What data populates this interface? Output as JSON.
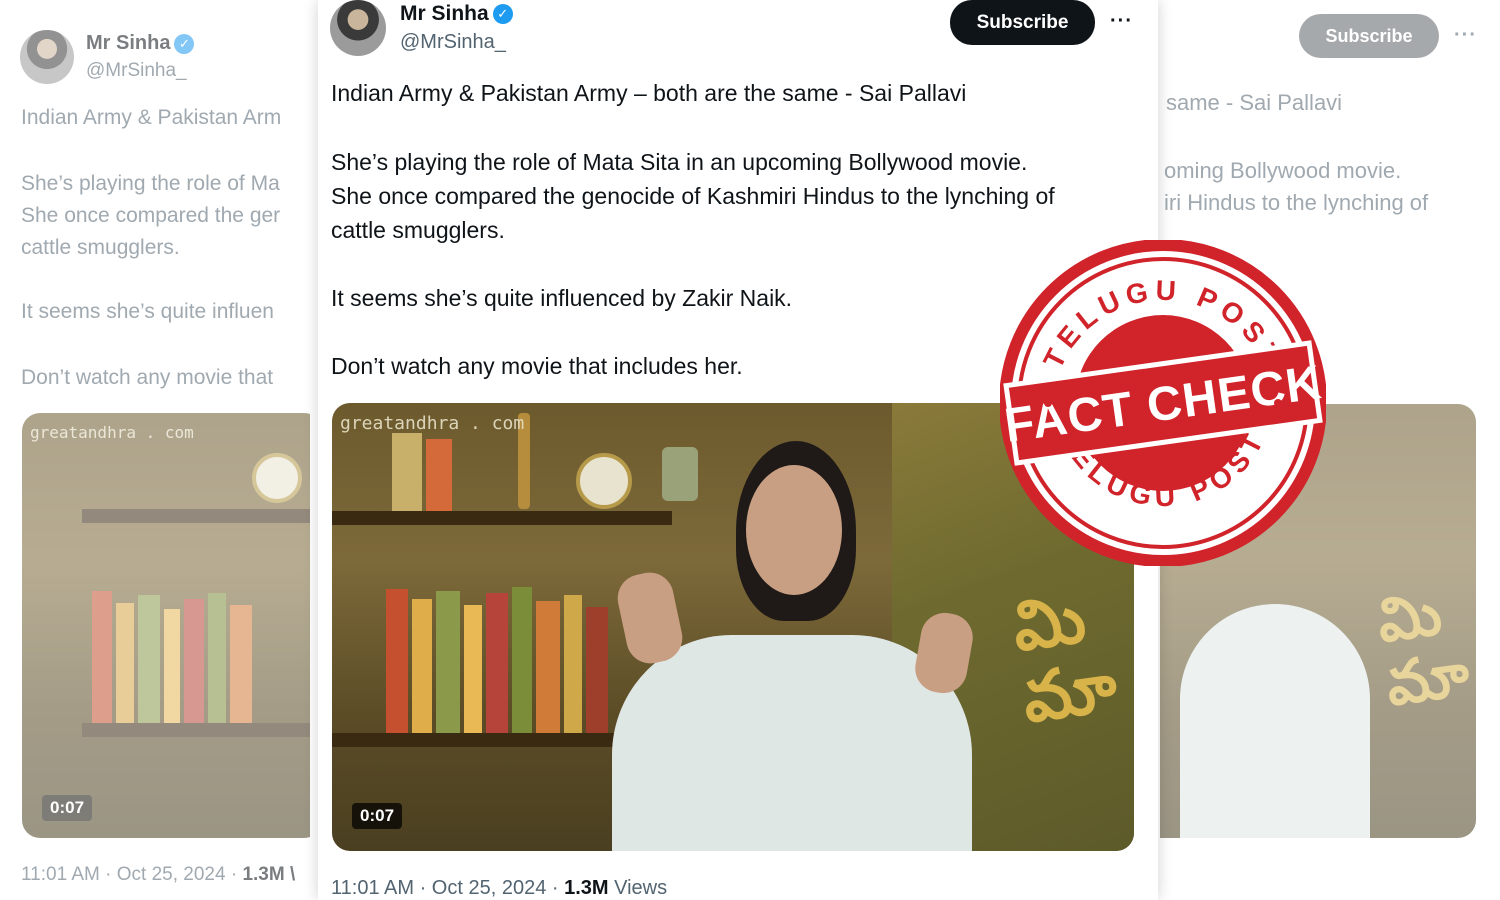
{
  "tweet": {
    "display_name": "Mr Sinha",
    "handle": "@MrSinha_",
    "subscribe_label": "Subscribe",
    "more_label": "···",
    "line1": "Indian Army & Pakistan Army – both are the same - Sai Pallavi",
    "line2": "She’s playing the role of Mata Sita in an upcoming Bollywood movie.",
    "line3": "She once compared the genocide of Kashmiri Hindus to the lynching of",
    "line4": "cattle smugglers.",
    "line5": "It seems she’s quite influenced by Zakir Naik.",
    "line6": "Don’t watch any movie that includes her.",
    "video_watermark": "greatandhra . com",
    "video_duration": "0:07",
    "sign_text": "మి\nమా",
    "timestamp": "11:01 AM · Oct 25, 2024 · ",
    "views_count": "1.3M",
    "views_label": " Views"
  },
  "left_ghost": {
    "display_name": "Mr Sinha",
    "handle": "@MrSinha_",
    "line1": "Indian Army & Pakistan Arm",
    "line2": "She’s playing the role of Ma",
    "line3": "She once compared the ger",
    "line4": "cattle smugglers.",
    "line5": "It seems she’s quite influen",
    "line6": "Don’t watch any movie that",
    "video_watermark": "greatandhra . com",
    "video_duration": "0:07",
    "timestamp": "11:01 AM · Oct 25, 2024 · ",
    "views_count": "1.3M \\"
  },
  "right_ghost": {
    "subscribe_label": "Subscribe",
    "more_label": "···",
    "line1": "same - Sai Pallavi",
    "line2": "oming Bollywood movie.",
    "line3": "iri Hindus to the lynching of"
  },
  "stamp": {
    "top_text": "TELUGU POST",
    "center_text": "FACT CHECK",
    "bottom_text": "TELUGU POST",
    "color": "#d1232a"
  },
  "icons": {
    "verified": "verified-badge-icon",
    "more": "more-options-icon"
  }
}
